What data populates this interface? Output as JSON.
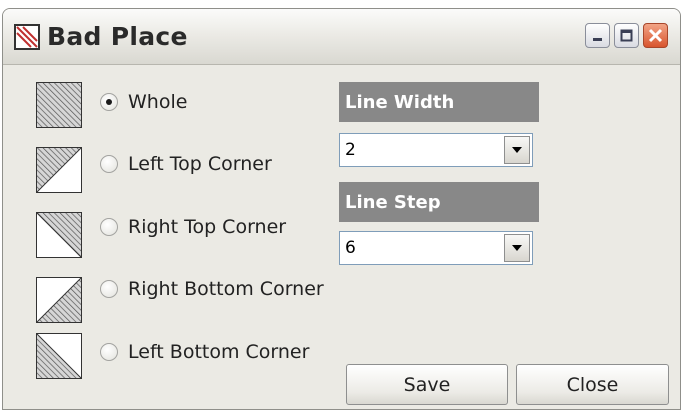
{
  "window": {
    "title": "Bad Place",
    "controls": [
      "minimize-icon",
      "maximize-icon",
      "close-icon"
    ]
  },
  "options": [
    {
      "label": "Whole",
      "checked": true,
      "pattern": "whole"
    },
    {
      "label": "Left Top Corner",
      "checked": false,
      "pattern": "left-top"
    },
    {
      "label": "Right Top Corner",
      "checked": false,
      "pattern": "right-top"
    },
    {
      "label": "Right Bottom Corner",
      "checked": false,
      "pattern": "right-bottom"
    },
    {
      "label": "Left Bottom Corner",
      "checked": false,
      "pattern": "left-bottom"
    }
  ],
  "line_width": {
    "label": "Line Width",
    "value": "2"
  },
  "line_step": {
    "label": "Line Step",
    "value": "6"
  },
  "buttons": {
    "save": "Save",
    "close": "Close"
  },
  "colors": {
    "section_bg": "#888888",
    "window_bg": "#ebeae4",
    "close_button": "#d8552e"
  }
}
